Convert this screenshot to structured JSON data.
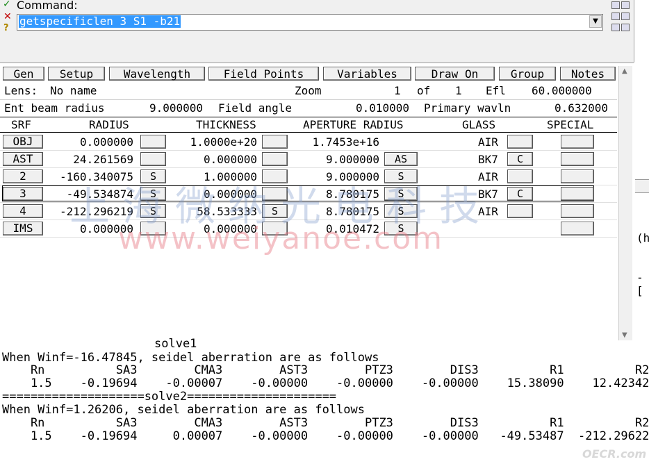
{
  "command": {
    "label": "Command:",
    "value": "getspecificlen 3 S1 -b21",
    "dropdown_icon": "▼"
  },
  "tabs": [
    "Gen",
    "Setup",
    "Wavelength",
    "Field Points",
    "Variables",
    "Draw On",
    "Group",
    "Notes"
  ],
  "info": {
    "lens_label": "Lens:",
    "lens_name": "No name",
    "zoom_label": "Zoom",
    "zoom_value": "1",
    "of_label": "of",
    "zoom_total": "1",
    "efl_label": "Efl",
    "efl_value": "60.000000",
    "ent_label": "Ent beam radius",
    "ent_value": "9.000000",
    "field_label": "Field angle",
    "field_value": "0.010000",
    "wavln_label": "Primary wavln",
    "wavln_value": "0.632000"
  },
  "headers": {
    "srf": "SRF",
    "radius": "RADIUS",
    "thickness": "THICKNESS",
    "aperture": "APERTURE RADIUS",
    "glass": "GLASS",
    "special": "SPECIAL"
  },
  "rows": [
    {
      "srf": "OBJ",
      "radius": "0.000000",
      "rs": "",
      "thickness": "1.0000e+20",
      "ts": "",
      "aperture": "1.7453e+16",
      "as": "",
      "glass": "AIR",
      "gs": ""
    },
    {
      "srf": "AST",
      "radius": "24.261569",
      "rs": "",
      "thickness": "0.000000",
      "ts": "",
      "aperture": "9.000000",
      "as": "AS",
      "glass": "BK7",
      "gs": "C"
    },
    {
      "srf": "2",
      "radius": "-160.340075",
      "rs": "S",
      "thickness": "1.000000",
      "ts": "",
      "aperture": "9.000000",
      "as": "S",
      "glass": "AIR",
      "gs": ""
    },
    {
      "srf": "3",
      "radius": "-49.534874",
      "rs": "S",
      "thickness": "0.000000",
      "ts": "",
      "aperture": "8.780175",
      "as": "S",
      "glass": "BK7",
      "gs": "C"
    },
    {
      "srf": "4",
      "radius": "-212.296219",
      "rs": "S",
      "thickness": "58.533333",
      "ts": "S",
      "aperture": "8.780175",
      "as": "S",
      "glass": "AIR",
      "gs": ""
    },
    {
      "srf": "IMS",
      "radius": "0.000000",
      "rs": "",
      "thickness": "0.000000",
      "ts": "",
      "aperture": "0.010472",
      "as": "S",
      "glass": "",
      "gs": ""
    }
  ],
  "watermark": {
    "cn": "上海微纳光电科技",
    "url": "www.weiyanoe.com"
  },
  "right_strip": {
    "h": "(h",
    "b": "-["
  },
  "console": {
    "partial": "solve1",
    "line1": "When Winf=-16.47845, seidel aberration are as follows",
    "cols1": "    Rn          SA3        CMA3        AST3        PTZ3        DIS3          R1          R2",
    "vals1": "    1.5    -0.19694    -0.00007    -0.00000    -0.00000    -0.00000    15.38090    12.42342",
    "sep": "====================solve2=====================",
    "line2": "When Winf=1.26206, seidel aberration are as follows",
    "cols2": "    Rn          SA3        CMA3        AST3        PTZ3        DIS3          R1          R2",
    "vals2": "    1.5    -0.19694     0.00007    -0.00000    -0.00000    -0.00000   -49.53487  -212.29622"
  },
  "footer_watermark": "OECR.com"
}
